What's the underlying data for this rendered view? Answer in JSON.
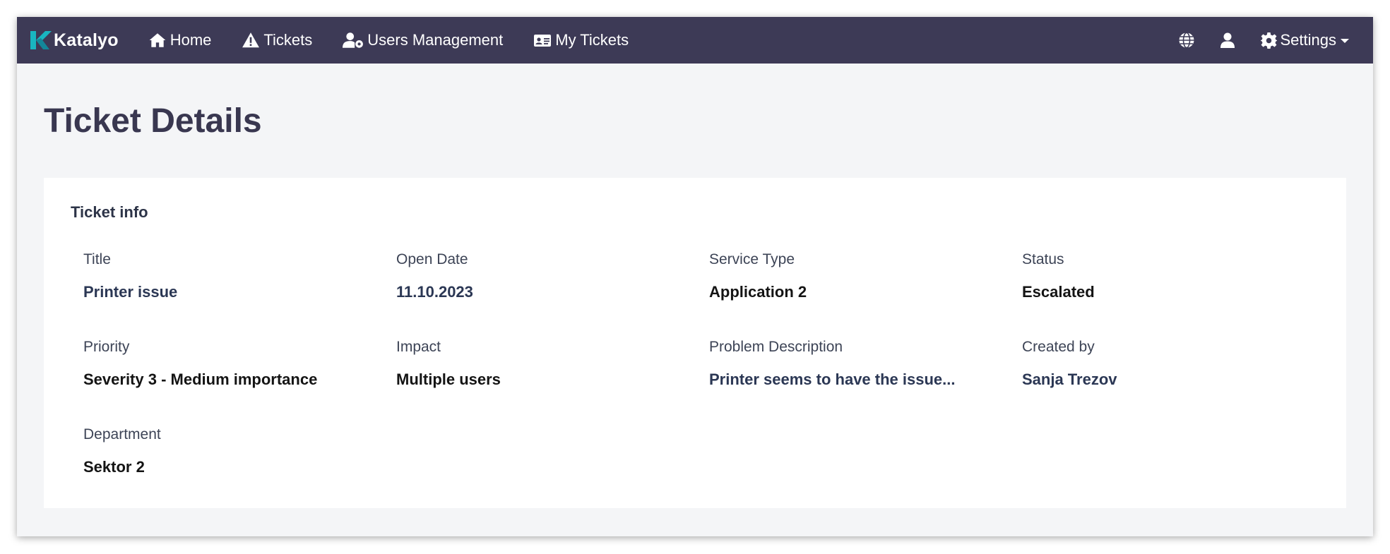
{
  "navbar": {
    "brand": "Katalyo",
    "items": [
      {
        "label": "Home",
        "icon": "home-icon"
      },
      {
        "label": "Tickets",
        "icon": "warning-icon"
      },
      {
        "label": "Users Management",
        "icon": "user-cog-icon"
      },
      {
        "label": "My Tickets",
        "icon": "id-card-icon"
      }
    ],
    "right_icons": [
      "globe-icon",
      "user-icon"
    ],
    "settings_label": "Settings"
  },
  "page": {
    "title": "Ticket Details"
  },
  "ticket_info": {
    "section_title": "Ticket info",
    "fields": [
      {
        "label": "Title",
        "value": "Printer issue"
      },
      {
        "label": "Open Date",
        "value": "11.10.2023"
      },
      {
        "label": "Service Type",
        "value": "Application 2"
      },
      {
        "label": "Status",
        "value": "Escalated"
      },
      {
        "label": "Priority",
        "value": "Severity 3 - Medium importance"
      },
      {
        "label": "Impact",
        "value": "Multiple users"
      },
      {
        "label": "Problem Description",
        "value": "Printer seems to have the issue..."
      },
      {
        "label": "Created by",
        "value": "Sanja Trezov"
      },
      {
        "label": "Department",
        "value": "Sektor 2"
      }
    ]
  },
  "colors": {
    "navbar_bg": "#3d3a56",
    "page_bg": "#f4f5f7",
    "brand_accent": "#19b5c0",
    "title_color": "#393750"
  }
}
